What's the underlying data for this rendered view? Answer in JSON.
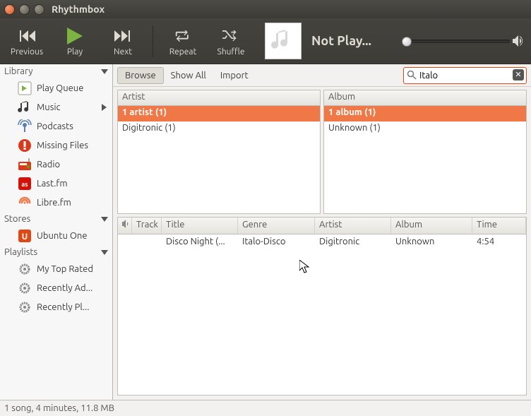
{
  "window": {
    "title": "Rhythmbox"
  },
  "toolbar": {
    "previous": "Previous",
    "play": "Play",
    "next": "Next",
    "repeat": "Repeat",
    "shuffle": "Shuffle",
    "status": "Not Play..."
  },
  "sidebar": {
    "library_hdr": "Library",
    "library": [
      {
        "label": "Play Queue",
        "icon": "queue"
      },
      {
        "label": "Music",
        "icon": "music",
        "expand": true
      },
      {
        "label": "Podcasts",
        "icon": "podcast"
      },
      {
        "label": "Missing Files",
        "icon": "error"
      },
      {
        "label": "Radio",
        "icon": "radio"
      },
      {
        "label": "Last.fm",
        "icon": "lastfm"
      },
      {
        "label": "Libre.fm",
        "icon": "librefm"
      }
    ],
    "stores_hdr": "Stores",
    "stores": [
      {
        "label": "Ubuntu One",
        "icon": "ubuntuone"
      }
    ],
    "playlists_hdr": "Playlists",
    "playlists": [
      {
        "label": "My Top Rated",
        "icon": "gear"
      },
      {
        "label": "Recently Ad...",
        "icon": "gear"
      },
      {
        "label": "Recently Pl...",
        "icon": "gear"
      }
    ]
  },
  "browsebar": {
    "browse": "Browse",
    "showall": "Show All",
    "import": "Import"
  },
  "search": {
    "value": "Italo",
    "placeholder": ""
  },
  "panes": {
    "artist_hdr": "Artist",
    "artist_rows": [
      "1 artist (1)",
      "Digitronic (1)"
    ],
    "album_hdr": "Album",
    "album_rows": [
      "1 album (1)",
      "Unknown (1)"
    ]
  },
  "tracks": {
    "headers": {
      "audio": "🔊",
      "track": "Track",
      "title": "Title",
      "genre": "Genre",
      "artist": "Artist",
      "album": "Album",
      "time": "Time"
    },
    "rows": [
      {
        "track": "",
        "title": "Disco Night (...",
        "genre": "Italo-Disco",
        "artist": "Digitronic",
        "album": "Unknown",
        "time": "4:54"
      }
    ]
  },
  "status": "1 song, 4 minutes, 11.8 MB"
}
